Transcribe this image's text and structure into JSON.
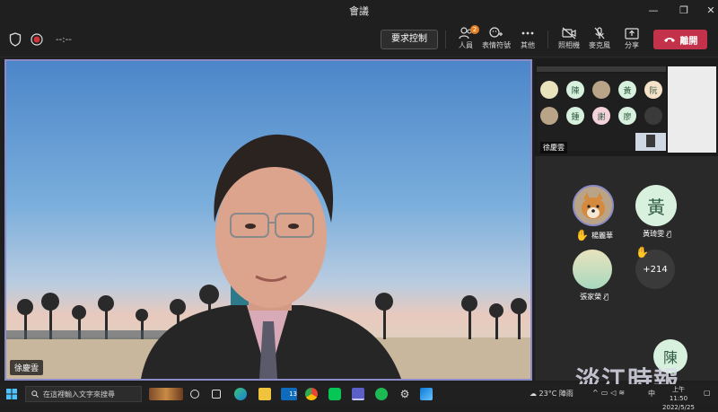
{
  "window": {
    "title": "會議",
    "minimize": "—",
    "restore": "❐",
    "close": "✕"
  },
  "toolbar": {
    "timer": "--:--",
    "request_control": "要求控制",
    "people": {
      "label": "人員",
      "badge": "2"
    },
    "reactions": "表情符號",
    "more": "其他",
    "camera": "照相機",
    "mic": "麥克風",
    "share": "分享",
    "leave": "離開",
    "leave_color": "#c4314b"
  },
  "stage": {
    "speaker_name": "徐慶雲",
    "border_color": "#8b8cc7"
  },
  "shared_content": {
    "presenter": "徐慶雲",
    "thumb_avatars": [
      "",
      "陳",
      "",
      "黃",
      "阮",
      "",
      "鍾",
      "謝",
      "廖",
      ""
    ]
  },
  "participants": [
    {
      "name": "楊麗華",
      "initial": "",
      "hand_raised": true,
      "muted": false
    },
    {
      "name": "黃琦雯",
      "initial": "黃",
      "hand_raised": false,
      "muted": true
    },
    {
      "name": "張家榮",
      "initial": "",
      "hand_raised": false,
      "muted": true
    }
  ],
  "overflow_count": "+214",
  "floating_avatar": "陳",
  "watermark": "淡江時報",
  "taskbar": {
    "search_placeholder": "在這裡輸入文字來搜尋",
    "weather": "23°C 陣雨",
    "lang": "中",
    "time": "上午 11:50",
    "date": "2022/5/25",
    "notification_count": "13"
  }
}
